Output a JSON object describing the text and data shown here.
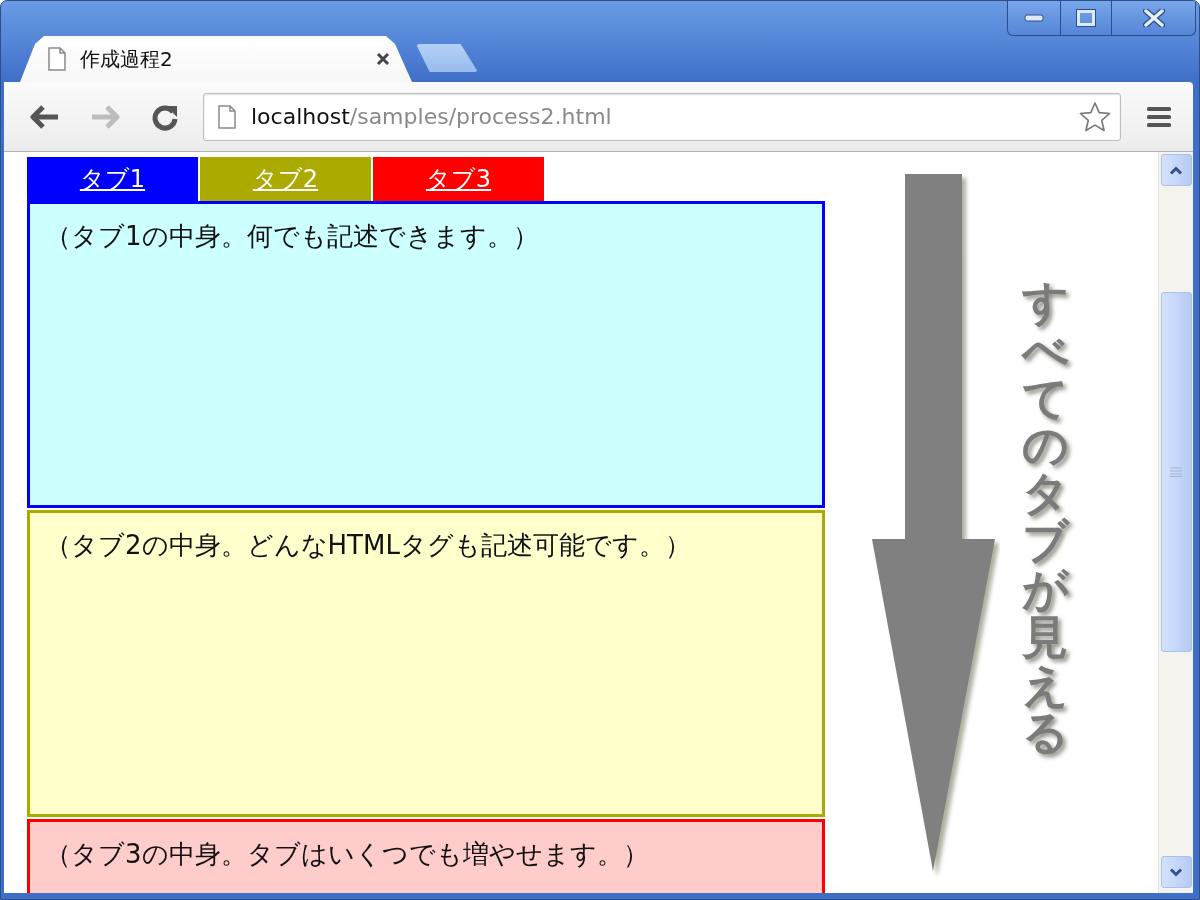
{
  "browser_tab": {
    "title": "作成過程2"
  },
  "toolbar": {
    "back": {
      "disabled": false
    },
    "forward": {
      "disabled": true
    }
  },
  "address_bar": {
    "host": "localhost",
    "path": "/samples/process2.html"
  },
  "page": {
    "tabs": [
      {
        "label": "タブ1",
        "color": "#0000ff"
      },
      {
        "label": "タブ2",
        "color": "#aaaa00"
      },
      {
        "label": "タブ3",
        "color": "#ff0000"
      }
    ],
    "panels": [
      {
        "text": "（タブ1の中身。何でも記述できます。）",
        "color": "#ccffff"
      },
      {
        "text": "（タブ2の中身。どんなHTMLタグも記述可能です。）",
        "color": "#ffffcc"
      },
      {
        "text": "（タブ3の中身。タブはいくつでも増やせます。）",
        "color": "#ffcccc"
      }
    ],
    "caption": "すべてのタブが見える"
  }
}
